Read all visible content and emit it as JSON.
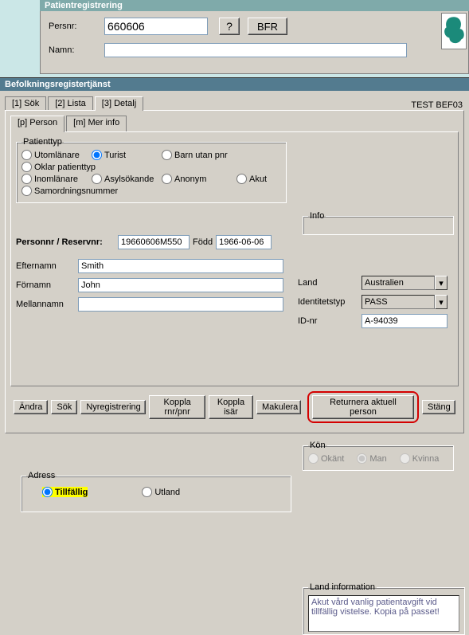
{
  "top": {
    "title": "Patientregistrering",
    "persnr_label": "Persnr:",
    "persnr_value": "660606",
    "namn_label": "Namn:",
    "namn_value": "",
    "question_btn": "?",
    "bfr_btn": "BFR"
  },
  "second_title": "Befolkningsregistertjänst",
  "tabs": {
    "t1": "[1] Sök",
    "t2": "[2] Lista",
    "t3": "[3] Detalj",
    "right_text": "TEST BEF03"
  },
  "subtabs": {
    "s1": "[p] Person",
    "s2": "[m] Mer info"
  },
  "patienttyp": {
    "legend": "Patienttyp",
    "r1": "Utomlänare",
    "r2": "Turist",
    "r3": "Barn utan pnr",
    "r4": "Oklar patienttyp",
    "r5": "Inomlänare",
    "r6": "Asylsökande",
    "r7": "Anonym",
    "r8": "Akut",
    "r9": "Samordningsnummer"
  },
  "info_legend": "Info",
  "personnr": {
    "label": "Personnr / Reservnr:",
    "value": "19660606M550",
    "fodd_label": "Född",
    "fodd_value": "1966-06-06"
  },
  "name": {
    "efternamn_lbl": "Efternamn",
    "efternamn_val": "Smith",
    "fornamn_lbl": "Förnamn",
    "fornamn_val": "John",
    "mellannamn_lbl": "Mellannamn",
    "mellannamn_val": ""
  },
  "adress": {
    "legend": "Adress",
    "tillfallig": "Tillfällig",
    "utland": "Utland"
  },
  "kon": {
    "legend": "Kön",
    "okant": "Okänt",
    "man": "Man",
    "kvinna": "Kvinna"
  },
  "right": {
    "land_lbl": "Land",
    "land_val": "Australien",
    "ident_lbl": "Identitetstyp",
    "ident_val": "PASS",
    "idnr_lbl": "ID-nr",
    "idnr_val": "A-94039"
  },
  "landinfo": {
    "legend": "Land information",
    "text": "Akut vård vanlig patientavgift vid tillfällig vistelse. Kopia på passet!"
  },
  "buttons": {
    "andra": "Ändra",
    "sok": "Sök",
    "nyreg": "Nyregistrering",
    "koppla_rnr": "Koppla rnr/pnr",
    "koppla_isar": "Koppla isär",
    "makulera": "Makulera",
    "returnera": "Returnera aktuell person",
    "stang": "Stäng"
  }
}
